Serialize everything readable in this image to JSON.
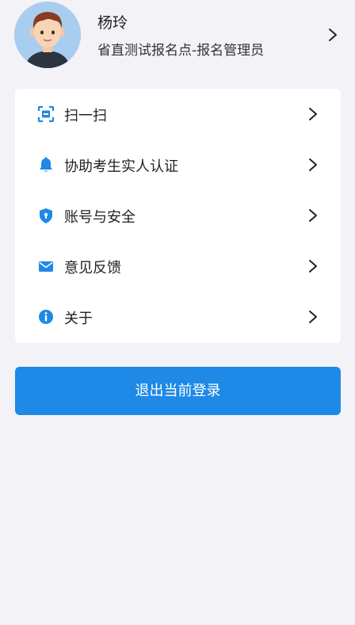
{
  "profile": {
    "name": "杨玲",
    "role": "省直测试报名点-报名管理员"
  },
  "menu": {
    "items": [
      {
        "label": "扫一扫",
        "icon": "scan-icon"
      },
      {
        "label": "协助考生实人认证",
        "icon": "bell-icon"
      },
      {
        "label": "账号与安全",
        "icon": "shield-icon"
      },
      {
        "label": "意见反馈",
        "icon": "mail-icon"
      },
      {
        "label": "关于",
        "icon": "info-icon"
      }
    ]
  },
  "logout": {
    "label": "退出当前登录"
  },
  "colors": {
    "accent": "#1e89e6",
    "background": "#f3f2f7"
  }
}
